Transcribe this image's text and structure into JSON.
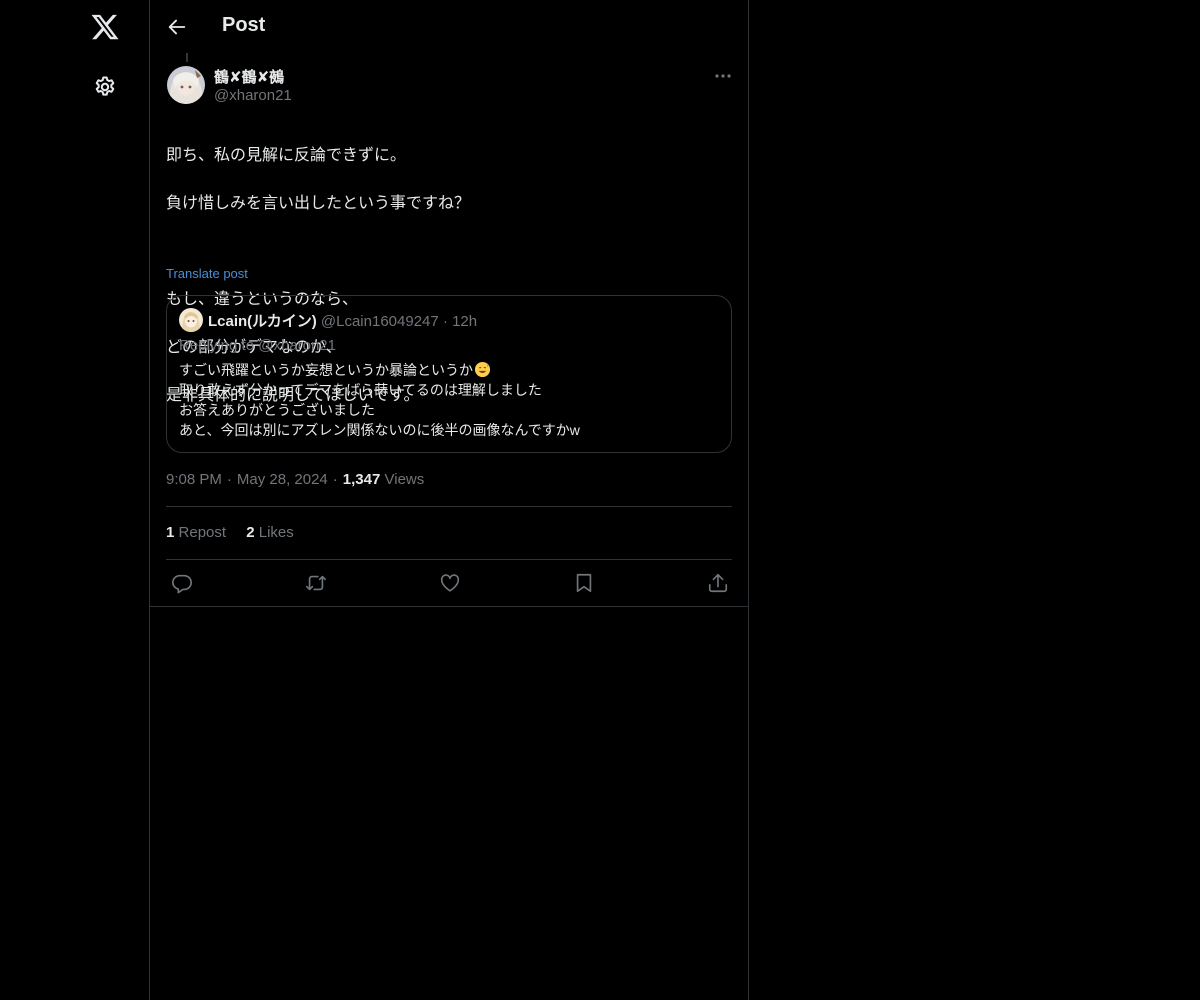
{
  "nav": {
    "logo_icon": "x-logo-icon",
    "settings_icon": "gear-icon"
  },
  "header": {
    "title": "Post",
    "back_icon": "arrow-left-icon"
  },
  "post": {
    "author_name": "鶴✘鶴✘鵺",
    "author_handle": "@xharon21",
    "text_lines": [
      "即ち、私の見解に反論できずに。",
      "負け惜しみを言い出したという事ですね？",
      "",
      "もし、違うというのなら、",
      "どの部分がデマなのか、",
      "是非具体的に説明してほしいです。"
    ],
    "translate_label": "Translate post",
    "quote": {
      "name": "Lcain(ルカイン)",
      "handle": "@Lcain16049247",
      "dot": "·",
      "time": "12h",
      "replying": "Replying to @xharon21",
      "text_lines": [
        "すごい飛躍というか妄想というか暴論というか",
        "取り敢えず分かってデマをばら蒔いてるのは理解しました",
        "お答えありがとうございました",
        "あと、今回は別にアズレン関係ないのに後半の画像なんですかw"
      ],
      "emoji_icon": "sweat-smile-emoji-icon"
    },
    "time": "9:08 PM",
    "dot": "·",
    "date": "May 28, 2024",
    "views_count": "1,347",
    "views_label": "Views",
    "reposts_count": "1",
    "reposts_label": "Repost",
    "likes_count": "2",
    "likes_label": "Likes"
  },
  "actions": [
    "reply-icon",
    "repost-icon",
    "like-icon",
    "bookmark-icon",
    "share-icon"
  ],
  "colors": {
    "background": "#000000",
    "text": "#e7e9ea",
    "muted": "#71767b",
    "border": "#2f3336",
    "link": "#4b8fd6"
  }
}
